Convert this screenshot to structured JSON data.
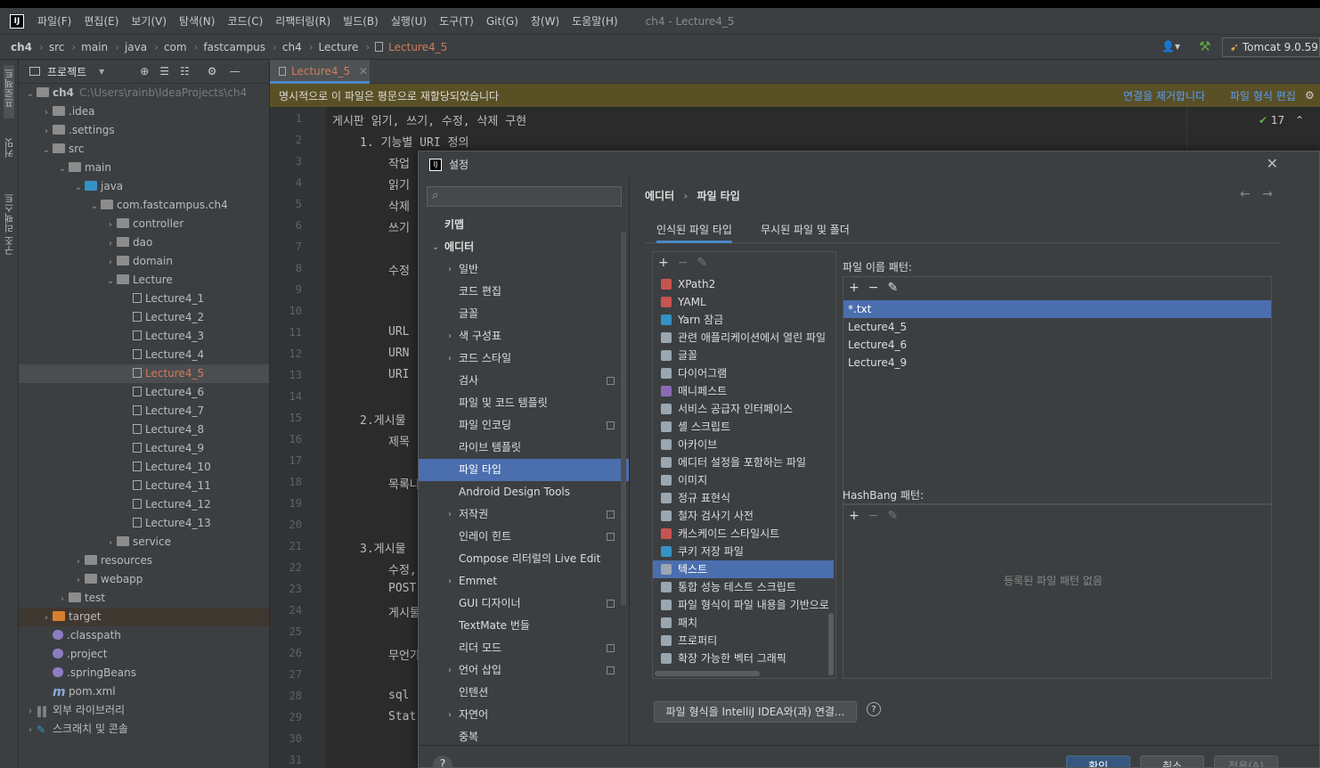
{
  "menubar": {
    "items": [
      "파일(F)",
      "편집(E)",
      "보기(V)",
      "탐색(N)",
      "코드(C)",
      "리팩터링(R)",
      "빌드(B)",
      "실행(U)",
      "도구(T)",
      "Git(G)",
      "창(W)",
      "도움말(H)"
    ],
    "window_title": "ch4 - Lecture4_5"
  },
  "navbar": {
    "crumbs": [
      "ch4",
      "src",
      "main",
      "java",
      "com",
      "fastcampus",
      "ch4",
      "Lecture",
      "Lecture4_5"
    ],
    "run_config": "Tomcat 9.0.59"
  },
  "leftstrip": {
    "project_label": "프로젝트",
    "commit_label": "커밋",
    "structure_label": "구조 리팩스트"
  },
  "project": {
    "header": "프로젝트",
    "root_name": "ch4",
    "root_path": "C:\\Users\\rainb\\IdeaProjects\\ch4",
    "items": [
      ".idea",
      ".settings",
      "src",
      "main",
      "java",
      "com.fastcampus.ch4",
      "controller",
      "dao",
      "domain",
      "Lecture",
      "Lecture4_1",
      "Lecture4_2",
      "Lecture4_3",
      "Lecture4_4",
      "Lecture4_5",
      "Lecture4_6",
      "Lecture4_7",
      "Lecture4_8",
      "Lecture4_9",
      "Lecture4_10",
      "Lecture4_11",
      "Lecture4_12",
      "Lecture4_13",
      "service",
      "resources",
      "webapp",
      "test",
      "target",
      ".classpath",
      ".project",
      ".springBeans",
      "pom.xml",
      "외부 라이브러리",
      "스크래치 및 콘솔"
    ]
  },
  "editor": {
    "tab": "Lecture4_5",
    "banner": "명시적으로 이 파일은 평문으로 재할당되었습니다",
    "banner_link1": "연결을 제거합니다",
    "banner_link2": "파일 형식 편집",
    "check_count": "17",
    "line_numbers": [
      "1",
      "2",
      "3",
      "4",
      "5",
      "6",
      "7",
      "8",
      "9",
      "10",
      "11",
      "12",
      "13",
      "14",
      "15",
      "16",
      "17",
      "18",
      "19",
      "20",
      "21",
      "22",
      "23",
      "24",
      "25",
      "26",
      "27",
      "28",
      "29",
      "30",
      "31"
    ],
    "lines": [
      "게시판 읽기, 쓰기, 수정, 삭제 구현",
      "1. 기능별 URI 정의",
      "작업",
      "읽기",
      "삭제",
      "쓰기",
      "수정",
      "URL",
      "URN",
      "URI",
      "2.게시물",
      "제목",
      "목록나",
      "3.게시물",
      "수정,",
      "POST",
      "게시물",
      "무언가",
      "sql",
      "Stat"
    ],
    "right_edge_text": "아서"
  },
  "dialog": {
    "title": "설정",
    "close": "✕",
    "sidebar": [
      {
        "label": "키맵",
        "lvl": 0,
        "arrow": ""
      },
      {
        "label": "에디터",
        "lvl": 0,
        "arrow": "⌄"
      },
      {
        "label": "일반",
        "lvl": 1,
        "arrow": "›"
      },
      {
        "label": "코드 편집",
        "lvl": 1,
        "arrow": ""
      },
      {
        "label": "글꼴",
        "lvl": 1,
        "arrow": ""
      },
      {
        "label": "색 구성표",
        "lvl": 1,
        "arrow": "›"
      },
      {
        "label": "코드 스타일",
        "lvl": 1,
        "arrow": "›"
      },
      {
        "label": "검사",
        "lvl": 1,
        "arrow": "",
        "icon": true
      },
      {
        "label": "파일 및 코드 템플릿",
        "lvl": 1,
        "arrow": ""
      },
      {
        "label": "파일 인코딩",
        "lvl": 1,
        "arrow": "",
        "icon": true
      },
      {
        "label": "라이브 템플릿",
        "lvl": 1,
        "arrow": ""
      },
      {
        "label": "파일 타입",
        "lvl": 1,
        "arrow": "",
        "sel": true
      },
      {
        "label": "Android Design Tools",
        "lvl": 1,
        "arrow": ""
      },
      {
        "label": "저작권",
        "lvl": 1,
        "arrow": "›",
        "icon": true
      },
      {
        "label": "인레이 힌트",
        "lvl": 1,
        "arrow": "",
        "icon": true
      },
      {
        "label": "Compose 리터럴의 Live Edit",
        "lvl": 1,
        "arrow": ""
      },
      {
        "label": "Emmet",
        "lvl": 1,
        "arrow": "›"
      },
      {
        "label": "GUI 디자이너",
        "lvl": 1,
        "arrow": "",
        "icon": true
      },
      {
        "label": "TextMate 번들",
        "lvl": 1,
        "arrow": ""
      },
      {
        "label": "리더 모드",
        "lvl": 1,
        "arrow": "",
        "icon": true
      },
      {
        "label": "언어 삽입",
        "lvl": 1,
        "arrow": "›",
        "icon": true
      },
      {
        "label": "인텐션",
        "lvl": 1,
        "arrow": ""
      },
      {
        "label": "자연어",
        "lvl": 1,
        "arrow": "›"
      },
      {
        "label": "중복",
        "lvl": 1,
        "arrow": ""
      }
    ],
    "breadcrumb": [
      "에디터",
      "파일 타입"
    ],
    "tabs": [
      "인식된 파일 타입",
      "무시된 파일 및 폴더"
    ],
    "filetypes": [
      {
        "label": "XPath2",
        "color": "#c75450"
      },
      {
        "label": "YAML",
        "color": "#c75450"
      },
      {
        "label": "Yarn 잠금",
        "color": "#3592c4"
      },
      {
        "label": "관련 애플리케이션에서 열린 파일",
        "color": "#9aa7b0"
      },
      {
        "label": "글꼴",
        "color": "#9aa7b0"
      },
      {
        "label": "다이어그램",
        "color": "#9aa7b0"
      },
      {
        "label": "매니페스트",
        "color": "#8c6ab6"
      },
      {
        "label": "서비스 공급자 인터페이스",
        "color": "#9aa7b0"
      },
      {
        "label": "셸 스크립트",
        "color": "#9aa7b0"
      },
      {
        "label": "아카이브",
        "color": "#9aa7b0"
      },
      {
        "label": "에디터 설정을 포함하는 파일",
        "color": "#9aa7b0"
      },
      {
        "label": "이미지",
        "color": "#9aa7b0"
      },
      {
        "label": "정규 표현식",
        "color": "#9aa7b0"
      },
      {
        "label": "철자 검사기 사전",
        "color": "#9aa7b0"
      },
      {
        "label": "캐스케이드 스타일시트",
        "color": "#c75450"
      },
      {
        "label": "쿠키 저장 파일",
        "color": "#3592c4"
      },
      {
        "label": "텍스트",
        "color": "#9aa7b0",
        "sel": true
      },
      {
        "label": "통합 성능 테스트 스크립트",
        "color": "#9aa7b0"
      },
      {
        "label": "파일 형식이 파일 내용을 기반으로",
        "color": "#9aa7b0"
      },
      {
        "label": "패치",
        "color": "#9aa7b0"
      },
      {
        "label": "프로퍼티",
        "color": "#9aa7b0"
      },
      {
        "label": "확장 가능한 벡터 그래픽",
        "color": "#9aa7b0"
      }
    ],
    "name_patterns_label": "파일 이름 패턴:",
    "name_patterns": [
      "*.txt",
      "Lecture4_5",
      "Lecture4_6",
      "Lecture4_9"
    ],
    "hashbang_label": "HashBang 패턴:",
    "hashbang_empty": "등록된 파일 패턴 없음",
    "associate_button": "파일 형식을 IntelliJ IDEA와(과) 연결...",
    "ok": "확인",
    "cancel": "취소",
    "apply": "적용(A)",
    "help": "?"
  }
}
